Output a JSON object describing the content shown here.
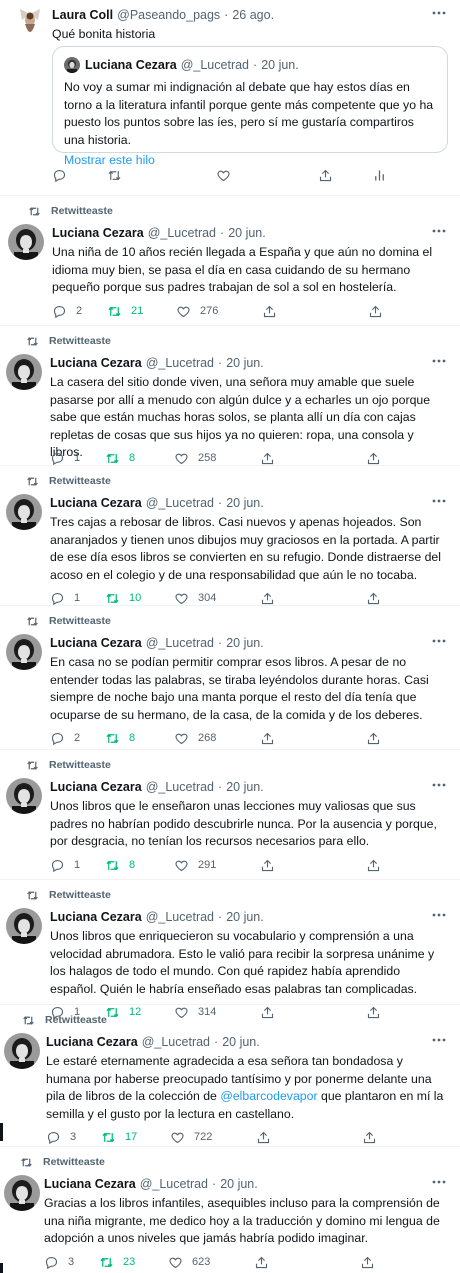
{
  "colors": {
    "accent": "#1d9bf0",
    "retweet_active": "#00ba7c",
    "secondary": "#536471",
    "border": "#eff3f4"
  },
  "first_tweet": {
    "name": "Laura Coll",
    "handle": "@Paseando_pags",
    "date": "26 ago.",
    "text": "Qué bonita historia",
    "quote": {
      "name": "Luciana Cezara",
      "handle": "@_Lucetrad",
      "date": "20 jun.",
      "text": "No voy a sumar mi indignación al debate que hay estos días en torno a la literatura infantil porque gente más competente que yo ha puesto los puntos sobre las íes, pero sí me gustaría compartiros una historia.",
      "show_thread": "Mostrar este hilo"
    },
    "icons": [
      "reply-icon",
      "retweet-icon",
      "like-icon",
      "share-icon",
      "analytics-icon"
    ]
  },
  "retweet_label": "Retwitteaste",
  "author": {
    "name": "Luciana Cezara",
    "handle": "@_Lucetrad",
    "date": "20 jun."
  },
  "tweets": [
    {
      "text": "Una niña de 10 años recién llegada a España y que aún no domina el idioma muy bien, se pasa el día en casa cuidando de su hermano pequeño porque sus padres trabajan de sol a sol en hostelería.",
      "replies": "2",
      "retweets": "21",
      "likes": "276"
    },
    {
      "text": "La casera del sitio donde viven, una señora muy amable que suele pasarse por allí a menudo con algún dulce y a echarles un ojo porque sabe que están muchas horas solos, se planta allí un día con cajas repletas de cosas que sus hijos ya no quieren: ropa, una consola y libros.",
      "replies": "1",
      "retweets": "8",
      "likes": "258"
    },
    {
      "text": "Tres cajas a rebosar de libros. Casi nuevos y apenas hojeados. Son anaranjados y tienen unos dibujos muy graciosos en la portada. A partir de ese día esos libros se convierten en su refugio. Donde distraerse del acoso en el colegio y de una responsabilidad que aún le no tocaba.",
      "replies": "1",
      "retweets": "10",
      "likes": "304"
    },
    {
      "text": "En casa no se podían permitir comprar esos libros. A pesar de no entender todas las palabras, se tiraba leyéndolos durante horas. Casi siempre de noche bajo una manta porque el resto del día tenía que ocuparse de su hermano, de la casa, de la comida y de los deberes.",
      "replies": "2",
      "retweets": "8",
      "likes": "268"
    },
    {
      "text": "Unos libros que le enseñaron unas lecciones muy valiosas que sus padres no habrían podido descubrirle nunca. Por la ausencia y porque, por desgracia, no tenían los recursos necesarios para ello.",
      "replies": "1",
      "retweets": "8",
      "likes": "291"
    },
    {
      "text": "Unos libros que enriquecieron su vocabulario y comprensión a una velocidad abrumadora. Esto le valió para recibir la sorpresa unánime y los halagos de todo el mundo. Con qué rapidez había aprendido español. Quién le habría enseñado esas palabras tan complicadas.",
      "replies": "1",
      "retweets": "12",
      "likes": "314"
    },
    {
      "text_before": "Le estaré eternamente agradecida a esa señora tan bondadosa y humana por haberse preocupado tantísimo y por ponerme delante una pila de libros de la colección de ",
      "mention": "@elbarcodevapor",
      "text_after": " que plantaron en mí la semilla y el gusto por la lectura en castellano.",
      "replies": "3",
      "retweets": "17",
      "likes": "722"
    },
    {
      "text": "Gracias a los libros infantiles, asequibles incluso para la comprensión de una niña migrante, me dedico hoy a la traducción y domino mi lengua de adopción a unos niveles que jamás habría podido imaginar.",
      "replies": "3",
      "retweets": "23",
      "likes": "623"
    }
  ]
}
